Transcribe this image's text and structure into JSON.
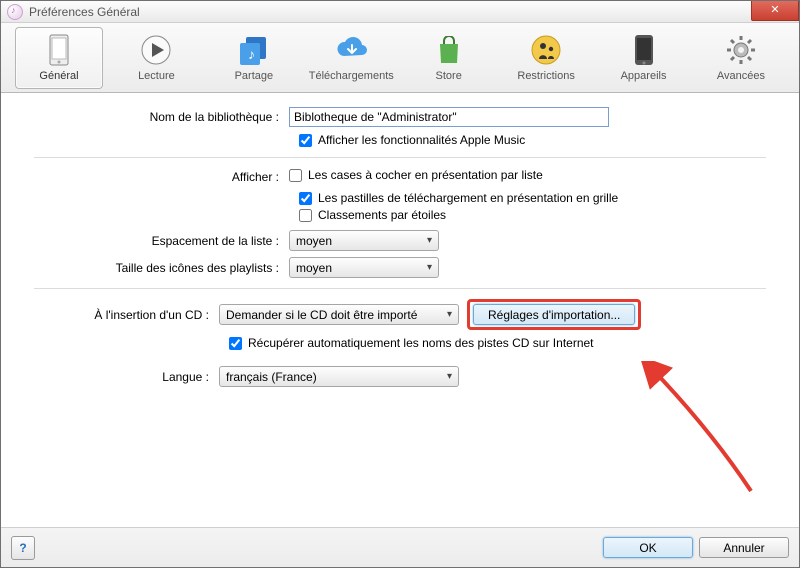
{
  "window": {
    "title": "Préférences Général"
  },
  "tabs": [
    {
      "label": "Général",
      "icon": "phone"
    },
    {
      "label": "Lecture",
      "icon": "play"
    },
    {
      "label": "Partage",
      "icon": "sharing"
    },
    {
      "label": "Téléchargements",
      "icon": "cloud"
    },
    {
      "label": "Store",
      "icon": "bag"
    },
    {
      "label": "Restrictions",
      "icon": "adult"
    },
    {
      "label": "Appareils",
      "icon": "device"
    },
    {
      "label": "Avancées",
      "icon": "gear"
    }
  ],
  "labels": {
    "library_name": "Nom de la bibliothèque :",
    "show_apple_music": "Afficher les fonctionnalités Apple Music",
    "display": "Afficher :",
    "list_checkboxes": "Les cases à cocher en présentation par liste",
    "grid_badges": "Les pastilles de téléchargement en présentation en grille",
    "star_ratings": "Classements par étoiles",
    "list_spacing": "Espacement de la liste :",
    "playlist_icon_size": "Taille des icônes des playlists :",
    "cd_insert": "À l'insertion d'un CD :",
    "import_settings": "Réglages d'importation...",
    "fetch_names": "Récupérer automatiquement les noms des pistes CD sur Internet",
    "language": "Langue :"
  },
  "values": {
    "library_name": "Biblotheque de \"Administrator\"",
    "show_apple_music": true,
    "list_checkboxes": false,
    "grid_badges": true,
    "star_ratings": false,
    "list_spacing": "moyen",
    "playlist_icon_size": "moyen",
    "cd_insert": "Demander si le CD doit être importé",
    "fetch_names": true,
    "language": "français (France)"
  },
  "footer": {
    "help": "?",
    "ok": "OK",
    "cancel": "Annuler"
  }
}
